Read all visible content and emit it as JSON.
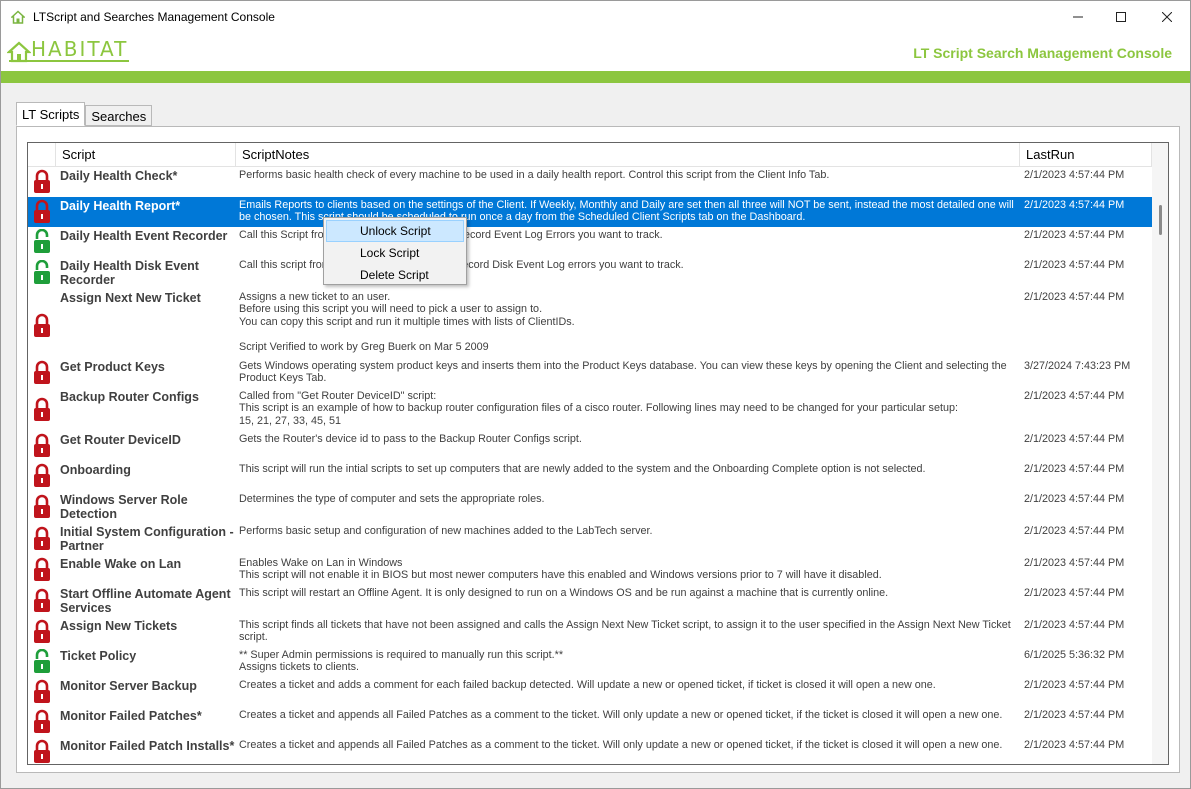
{
  "window": {
    "title": "LTScript and Searches Management Console"
  },
  "header": {
    "logo_text": "HABITAT",
    "title": "LT Script  Search Management Console"
  },
  "tabs": [
    {
      "label": "LT Scripts",
      "active": true
    },
    {
      "label": "Searches",
      "active": false
    }
  ],
  "grid": {
    "columns": {
      "script": "Script",
      "notes": "ScriptNotes",
      "lastrun": "LastRun"
    },
    "rows": [
      {
        "lock": "locked",
        "script": "Daily Health Check*",
        "notes": "Performs basic health check of every machine to be used in a daily health report. Control this script from the Client Info Tab.",
        "lastrun": "2/1/2023 4:57:44 PM"
      },
      {
        "lock": "locked",
        "script": "Daily Health Report*",
        "notes": "Emails Reports to clients based on the settings of the Client. If Weekly, Monthly and Daily are set then all three will NOT be sent, instead the most detailed one will be chosen. This script should be scheduled to run once a day from the Scheduled Client Scripts tab on the Dashboard.",
        "lastrun": "2/1/2023 4:57:44 PM",
        "selected": true
      },
      {
        "lock": "unlocked",
        "script": "Daily Health Event Recorder",
        "notes": "Call this Script from the Daily Health Check to record Event Log Errors you want to track.",
        "lastrun": "2/1/2023 4:57:44 PM"
      },
      {
        "lock": "unlocked",
        "script": "Daily Health Disk Event Recorder",
        "notes": "Call this script from the Daily Health Check to record Disk Event Log errors you want to track.",
        "lastrun": "2/1/2023 4:57:44 PM"
      },
      {
        "lock": "locked",
        "script": "Assign Next New Ticket",
        "notes": "Assigns a new ticket to an user.\nBefore using this script you will need to pick a user to assign to.\nYou can copy this script and run it multiple times with lists of ClientIDs.\n\nScript Verified to work by Greg Buerk on Mar 5 2009",
        "lastrun": "2/1/2023 4:57:44 PM"
      },
      {
        "lock": "locked",
        "script": "Get Product Keys",
        "notes": "Gets Windows operating system product keys and inserts them into the Product Keys database. You can view these keys by opening the Client and selecting the Product Keys Tab.",
        "lastrun": "3/27/2024 7:43:23 PM"
      },
      {
        "lock": "locked",
        "script": "Backup Router Configs",
        "notes": "Called from \"Get Router DeviceID\" script:\nThis script is an example of how to backup router configuration files of a cisco router. Following lines may need to be changed for your particular setup:\n15, 21, 27, 33, 45, 51",
        "lastrun": "2/1/2023 4:57:44 PM"
      },
      {
        "lock": "locked",
        "script": "Get Router DeviceID",
        "notes": "Gets the Router's device id to pass to the Backup Router Configs script.",
        "lastrun": "2/1/2023 4:57:44 PM"
      },
      {
        "lock": "locked",
        "script": "Onboarding",
        "notes": "This script will run the intial scripts to set up computers that are newly added to the system and the Onboarding Complete option is not selected.",
        "lastrun": "2/1/2023 4:57:44 PM"
      },
      {
        "lock": "locked",
        "script": "Windows Server Role Detection",
        "notes": "Determines the type of computer and sets the appropriate roles.",
        "lastrun": "2/1/2023 4:57:44 PM"
      },
      {
        "lock": "locked",
        "script": "Initial System Configuration - Partner",
        "notes": "Performs basic setup and configuration of new machines added to the LabTech server.",
        "lastrun": "2/1/2023 4:57:44 PM"
      },
      {
        "lock": "locked",
        "script": "Enable Wake on Lan",
        "notes": "Enables Wake on Lan in Windows\nThis script will not enable it in BIOS but most newer computers have this enabled and Windows versions prior to 7 will have it disabled.",
        "lastrun": "2/1/2023 4:57:44 PM"
      },
      {
        "lock": "locked",
        "script": "Start Offline Automate Agent Services",
        "notes": "This script will restart an Offline Agent.  It is only designed to run on a Windows OS and be run against a machine that is currently online.",
        "lastrun": "2/1/2023 4:57:44 PM"
      },
      {
        "lock": "locked",
        "script": "Assign New Tickets",
        "notes": "This script finds all tickets that have not been assigned and calls the Assign Next New Ticket script, to assign it to the user specified in the Assign Next New Ticket script.",
        "lastrun": "2/1/2023 4:57:44 PM"
      },
      {
        "lock": "unlocked",
        "script": "Ticket Policy",
        "notes": "** Super Admin permissions is required to manually run this script.**\nAssigns tickets to clients.",
        "lastrun": "6/1/2025 5:36:32 PM"
      },
      {
        "lock": "locked",
        "script": "Monitor Server Backup",
        "notes": "Creates a ticket and adds a comment for each failed backup detected. Will update a new or opened ticket, if ticket is closed it will open a new one.",
        "lastrun": "2/1/2023 4:57:44 PM"
      },
      {
        "lock": "locked",
        "script": "Monitor Failed Patches*",
        "notes": "Creates a ticket and appends all Failed Patches as a comment to the ticket. Will only update a new or opened ticket, if the ticket is closed it will open a new one.",
        "lastrun": "2/1/2023 4:57:44 PM"
      },
      {
        "lock": "locked",
        "script": "Monitor Failed Patch Installs*",
        "notes": "Creates a ticket and appends all Failed Patches as a comment to the ticket. Will only update a new or opened ticket, if the ticket is closed it will open a new one.",
        "lastrun": "2/1/2023 4:57:44 PM"
      }
    ]
  },
  "context_menu": {
    "items": [
      "Unlock Script",
      "Lock Script",
      "Delete Script"
    ]
  },
  "colors": {
    "accent_green": "#8cc63f",
    "lock_red": "#c0141c",
    "lock_green": "#1e9e3a",
    "selection": "#0078d7"
  }
}
